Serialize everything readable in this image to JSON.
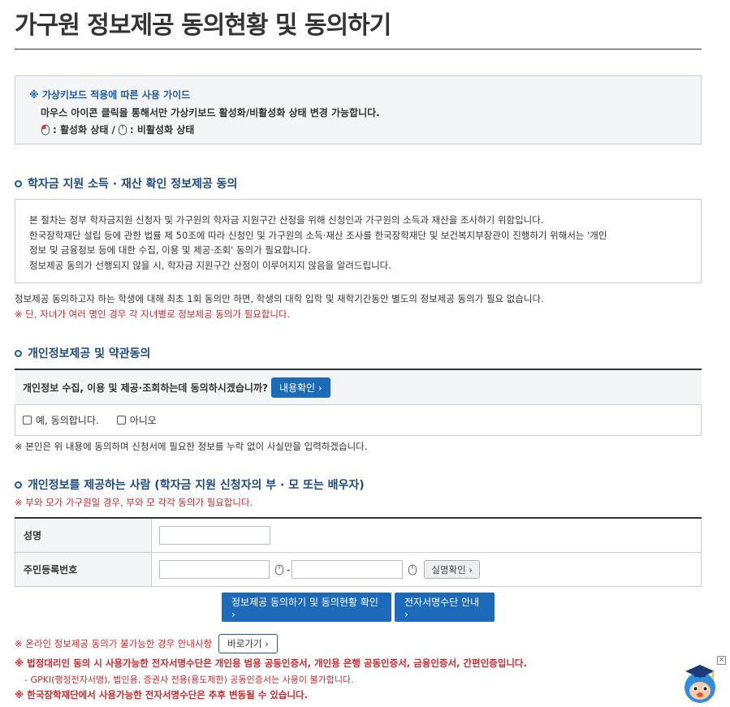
{
  "page": {
    "title": "가구원 정보제공 동의현황 및 동의하기"
  },
  "guide": {
    "title": "※ 가상키보드 적용에 따른 사용 가이드",
    "line1": "마우스 아이콘 클릭을 통해서만 가상키보드 활성화/비활성화 상태 변경 가능합니다.",
    "active_label": ": 활성화 상태 /",
    "inactive_label": ": 비활성화 상태"
  },
  "section1": {
    "title": "학자금 지원 소득 · 재산 확인 정보제공 동의",
    "info_lines": [
      "본 절차는 정부 학자금지원 신청자 및 가구원의 학자금 지원구간 산정을 위해 신청인과 가구원의 소득과 재산을 조사하기 위함입니다.",
      "한국장학재단 설립 등에 관한 법률 제 50조에 따라 신청인 및 가구원의 소득·재산 조사를 한국장학재단 및 보건복지부장관이 진행하기 위해서는 '개인",
      "정보 및 금융정보 등에 대한 수집, 이용 및 제공·조회' 동의가 필요합니다.",
      "정보제공 동의가 선행되지 않을 시, 학자금 지원구간 산정이 이루어지지 않음을 알려드립니다."
    ],
    "note": "정보제공 동의하고자 하는 학생에 대해 최초 1회 동의만 하면, 학생의 대학 입학 및 재학기간동안 별도의 정보제공 동의가 필요 없습니다.",
    "note_red": "※ 단, 자녀가 여러 명인 경우 각 자녀별로 정보제공 동의가 필요합니다."
  },
  "section2": {
    "title": "개인정보제공 및 약관동의",
    "question": "개인정보 수집, 이용 및 제공·조회하는데 동의하시겠습니까?",
    "view_button": "내용확인 ›",
    "option_yes": "예, 동의합니다.",
    "option_no": "아니오",
    "note": "※ 본인은 위 내용에 동의하며 신청서에 필요한 정보를 누락 없이 사실만을 입력하겠습니다."
  },
  "section3": {
    "title": "개인정보를 제공하는 사람 (학자금 지원 신청자의 부 · 모 또는 배우자)",
    "note_red": "※ 부와 모가 가구원일 경우, 부와 모 각각 동의가 필요합니다.",
    "name_label": "성명",
    "rrn_label": "주민등록번호",
    "rrn_separator": "-",
    "verify_button": "실명확인 ›"
  },
  "actions": {
    "consent_button": "정보제공 동의하기 및 동의현황 확인 ›",
    "cert_button": "전자서명수단 안내 ›"
  },
  "footer": {
    "offline_note": "※ 온라인 정보제공 동의가 불가능한 경우 안내사항",
    "goto_button": "바로가기 ›",
    "legal_note": "※ 법정대리인 동의 시 사용가능한 전자서명수단은 개인용 범용 공동인증서, 개인용 은행 공동인증서, 금융인증서, 간편인증입니다.",
    "gpki_note": "- GPKI(행정전자서명), 법인용, 증권사 전용(용도제한) 공동인증서는 사용이 불가합니다.",
    "change_note": "※ 한국장학재단에서 사용가능한 전자서명수단은 추후 변동될 수 있습니다."
  },
  "chatbot": {
    "close_label": "×",
    "icon": "mascot-icon"
  }
}
